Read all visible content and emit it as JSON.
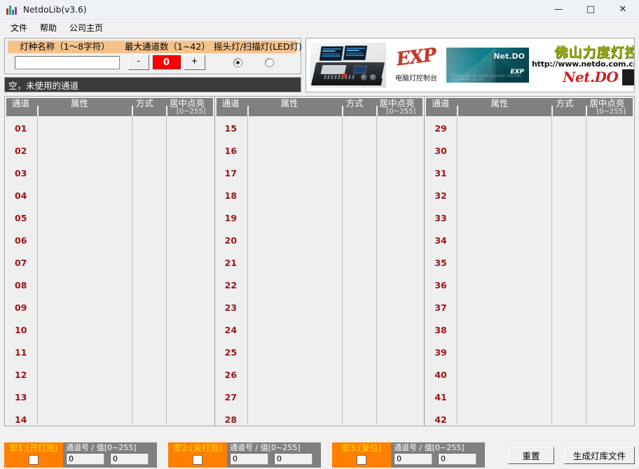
{
  "window": {
    "title": "NetdoLib(v3.6)",
    "icon": "app-bars-icon",
    "minimize": "—",
    "maximize": "□",
    "close": "✕"
  },
  "menu": {
    "items": [
      {
        "label": "文件"
      },
      {
        "label": "帮助"
      },
      {
        "label": "公司主页"
      }
    ]
  },
  "form": {
    "name_label": "灯种名称（1～8字符）",
    "name_value": "",
    "name_placeholder": "",
    "max_label": "最大通道数（1~42）",
    "minus_label": "-",
    "plus_label": "+",
    "count_value": "0",
    "type_label": "摇头灯/扫描灯(LED灯)",
    "radio_a_selected": true,
    "radio_b_selected": false
  },
  "status": {
    "text": "空，未使用的通道"
  },
  "banner": {
    "exp_word": "EXP",
    "exp_sub": "电脑灯控制台",
    "thumb_netdo": "Net.DO",
    "thumb_exp": "EXP",
    "thumb_tiny": "FOSHAN NET.DO STAGE LIGHTING CONTROL EQUIPMENT CO.,LTD",
    "brand_cn": "佛山力度灯控",
    "brand_url": "http://www.netdo.com.cn",
    "brand_netdo": "Net.DO"
  },
  "table": {
    "headers": {
      "channel": "通道",
      "attribute": "属性",
      "mode": "方式",
      "center": "居中点亮",
      "center_range": "[0~255]"
    },
    "columns": [
      {
        "rows": [
          "01",
          "02",
          "03",
          "04",
          "05",
          "06",
          "07",
          "08",
          "09",
          "10",
          "11",
          "12",
          "13",
          "14"
        ]
      },
      {
        "rows": [
          "15",
          "16",
          "17",
          "18",
          "19",
          "20",
          "21",
          "22",
          "23",
          "24",
          "25",
          "26",
          "27",
          "28"
        ]
      },
      {
        "rows": [
          "29",
          "30",
          "31",
          "32",
          "33",
          "34",
          "35",
          "36",
          "37",
          "38",
          "39",
          "40",
          "41",
          "42"
        ]
      }
    ]
  },
  "macros": [
    {
      "label": "宏1:(开灯泡)",
      "checked": false,
      "fields_caption": "通道号 / 值[0~255]",
      "channel_value": "0",
      "value_value": "0"
    },
    {
      "label": "宏2:(关灯泡)",
      "checked": false,
      "fields_caption": "通道号 / 值[0~255]",
      "channel_value": "0",
      "value_value": "0"
    },
    {
      "label": "宏3:(复位)",
      "checked": false,
      "fields_caption": "通道号 / 值[0~255]",
      "channel_value": "0",
      "value_value": "0"
    }
  ],
  "actions": {
    "reset": "重置",
    "generate": "生成灯库文件"
  },
  "colors": {
    "label_orange": "#f6c28b",
    "macro_orange": "#ff8000",
    "macro_text_yellow": "#ffe000",
    "count_red": "#ff0000",
    "channel_red": "#9b1414",
    "header_gray": "#808080",
    "status_dark": "#3b3b3b"
  }
}
